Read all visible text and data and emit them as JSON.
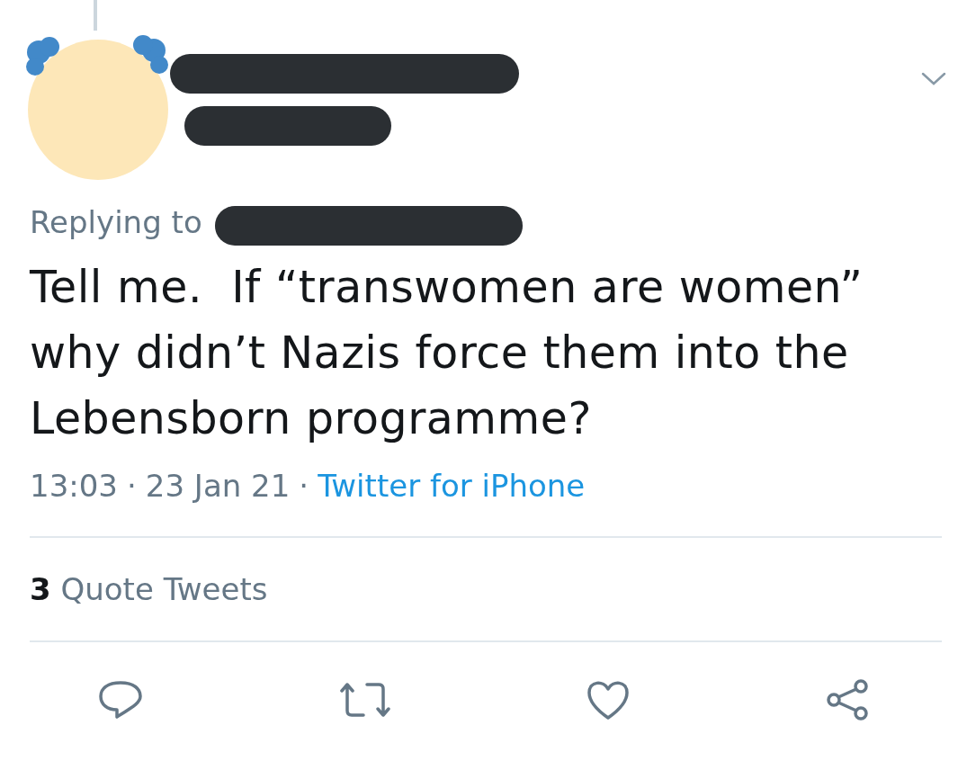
{
  "tweet": {
    "replying_to": "Replying to",
    "text": "Tell me.  If “transwomen are women” why didn’t Nazis force them into the Lebensborn programme?",
    "time": "13:03",
    "separator": "·",
    "date": "23 Jan 21",
    "source": "Twitter for iPhone",
    "quote_count": "3",
    "quote_label": "Quote Tweets"
  },
  "actions": [
    {
      "kind": "reply"
    },
    {
      "kind": "retweet"
    },
    {
      "kind": "like"
    },
    {
      "kind": "share"
    }
  ]
}
